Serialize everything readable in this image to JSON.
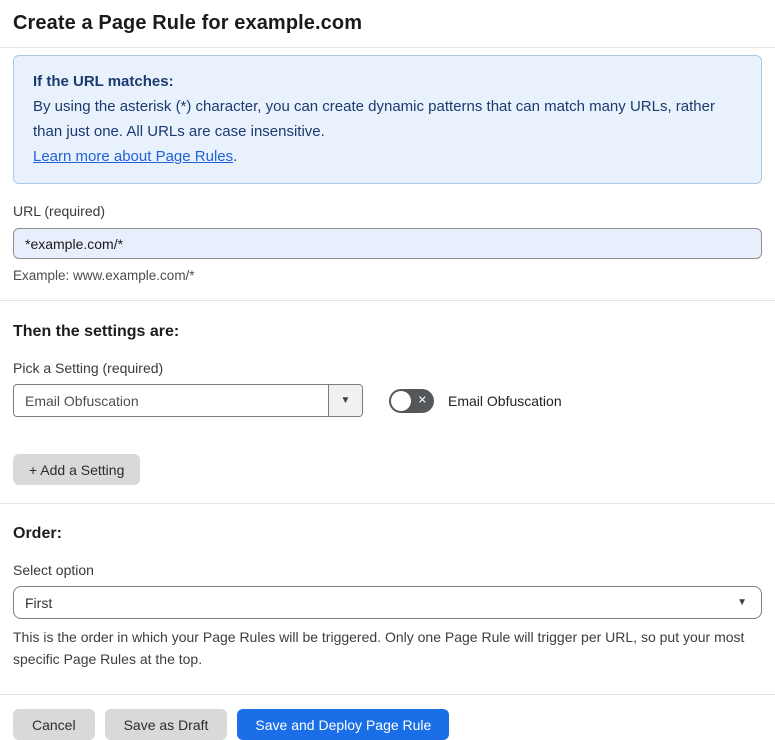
{
  "title": "Create a Page Rule for example.com",
  "info_box": {
    "heading": "If the URL matches:",
    "body": "By using the asterisk (*) character, you can create dynamic patterns that can match many URLs, rather than just one. All URLs are case insensitive.",
    "link": "Learn more about Page Rules",
    "link_suffix": "."
  },
  "url_field": {
    "label": "URL (required)",
    "value": "*example.com/*",
    "helper": "Example: www.example.com/*"
  },
  "settings_section": {
    "heading": "Then the settings are:",
    "pick_label": "Pick a Setting (required)",
    "selected_setting": "Email Obfuscation",
    "toggle_label": "Email Obfuscation",
    "toggle_state": "off",
    "add_button": "+ Add a Setting"
  },
  "order_section": {
    "heading": "Order:",
    "select_label": "Select option",
    "selected_option": "First",
    "description": "This is the order in which your Page Rules will be triggered. Only one Page Rule will trigger per URL, so put your most specific Page Rules at the top."
  },
  "footer": {
    "cancel": "Cancel",
    "save_draft": "Save as Draft",
    "save_deploy": "Save and Deploy Page Rule"
  },
  "icons": {
    "caret_down": "▼",
    "toggle_x": "✕"
  },
  "colors": {
    "accent_blue": "#1a6ee8",
    "info_bg": "#e9f2fc",
    "info_border": "#a9cbe8",
    "info_text": "#1b3a70",
    "link_blue": "#2061d6",
    "input_autofill_bg": "#e8eefc",
    "toggle_off_bg": "#54585a",
    "button_gray": "#d9d9d9"
  }
}
